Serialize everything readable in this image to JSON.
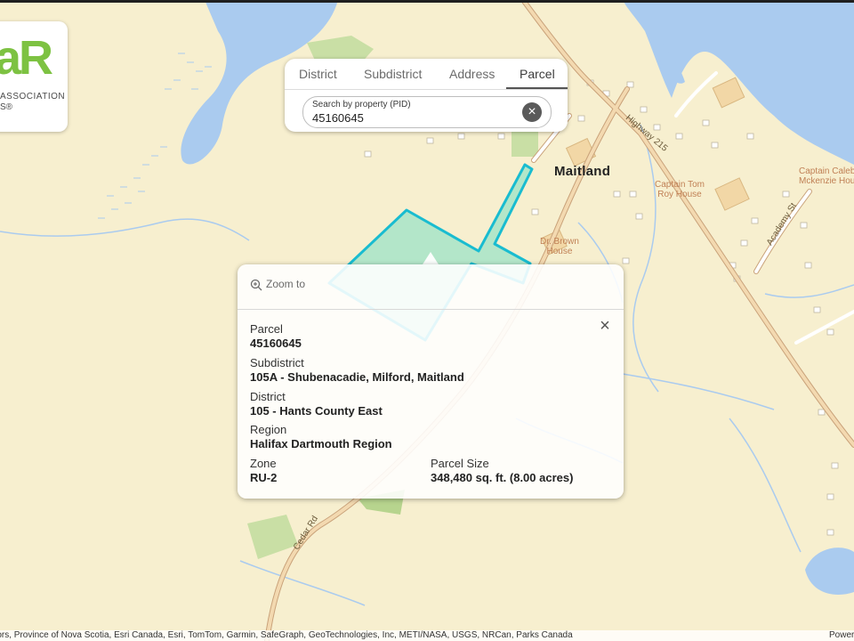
{
  "logo": {
    "big_text": "aR",
    "line1": "ASSOCIATION",
    "line2": "S®"
  },
  "search": {
    "tabs": [
      "District",
      "Subdistrict",
      "Address",
      "Parcel"
    ],
    "active_tab": "Parcel",
    "field_caption": "Search by property (PID)",
    "field_value": "45160645"
  },
  "map_labels": {
    "town": "Maitland",
    "highway": "Highway 215",
    "poi_captain_tom": [
      "Captain Tom",
      "Roy House"
    ],
    "poi_dr_brown": [
      "Dr. Brown",
      "House"
    ],
    "poi_captain_caleb": [
      "Captain Caleb",
      "Mckenzie House"
    ],
    "road_academy": "Academy St",
    "road_cedar": "Cedar Rd"
  },
  "popup": {
    "zoom_label": "Zoom to",
    "parcel_label": "Parcel",
    "parcel_value": "45160645",
    "subdistrict_label": "Subdistrict",
    "subdistrict_value": "105A - Shubenacadie, Milford, Maitland",
    "district_label": "District",
    "district_value": "105 - Hants County East",
    "region_label": "Region",
    "region_value": "Halifax Dartmouth Region",
    "zone_label": "Zone",
    "zone_value": "RU-2",
    "size_label": "Parcel Size",
    "size_value": "348,480 sq. ft. (8.00 acres)"
  },
  "attribution": {
    "text": "utors, Province of Nova Scotia, Esri Canada, Esri, TomTom, Garmin, SafeGraph, GeoTechnologies, Inc, METI/NASA, USGS, NRCan, Parks Canada",
    "powered": "Power"
  },
  "colors": {
    "land": "#f7efcf",
    "water": "#aacbef",
    "park": "#c9dfa5",
    "road_fill": "#f3d9b0",
    "road_casing": "#c9a27a",
    "parcel_outline": "#19bcd0",
    "parcel_fill": "#8fe0c6",
    "logo_green": "#7dc242"
  }
}
